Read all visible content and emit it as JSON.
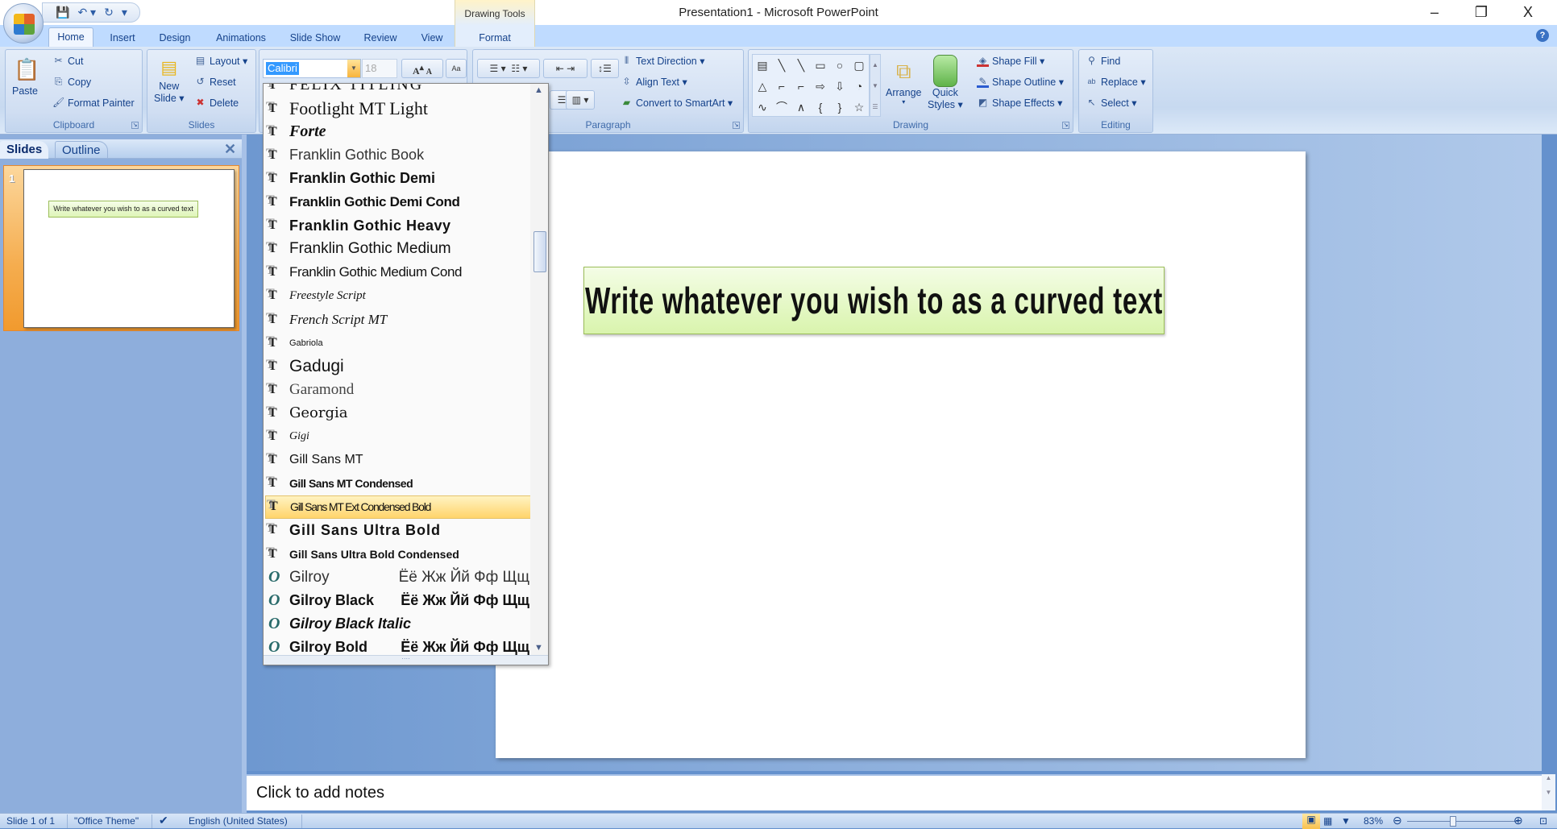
{
  "window": {
    "title": "Presentation1 - Microsoft PowerPoint",
    "minimize": "–",
    "restore": "❐",
    "close": "X"
  },
  "qat": {
    "save": "💾",
    "undo": "↶ ▾",
    "redo": "↻",
    "customize": "▾"
  },
  "contextual": {
    "header": "Drawing Tools"
  },
  "tabs": [
    "Home",
    "Insert",
    "Design",
    "Animations",
    "Slide Show",
    "Review",
    "View",
    "Format"
  ],
  "help": "?",
  "ribbon": {
    "clipboard": {
      "label": "Clipboard",
      "paste": "Paste",
      "cut": "Cut",
      "copy": "Copy",
      "format_painter": "Format Painter"
    },
    "slides": {
      "label": "Slides",
      "new_slide": "New",
      "new_slide2": "Slide ▾",
      "layout": "Layout ▾",
      "reset": "Reset",
      "delete": "Delete"
    },
    "font": {
      "font_name": "Calibri",
      "font_size": "18",
      "grow": "A",
      "shrink": "A",
      "clear": "Aa"
    },
    "paragraph": {
      "label": "Paragraph",
      "text_direction": "Text Direction ▾",
      "align_text": "Align Text ▾",
      "convert_smartart": "Convert to SmartArt ▾"
    },
    "drawing": {
      "label": "Drawing",
      "shapes": [
        "▤",
        "╲",
        "╲",
        "▭",
        "○",
        "▢",
        "△",
        "⌐",
        "⌐",
        "⇨",
        "⇩",
        "◔",
        "∿",
        "⌒",
        "∧",
        "{",
        "}",
        "☆"
      ],
      "arrange": "Arrange",
      "arrange_arrow": "▾",
      "quick_styles": "Quick",
      "quick_styles2": "Styles ▾",
      "shape_fill": "Shape Fill ▾",
      "shape_outline": "Shape Outline ▾",
      "shape_effects": "Shape Effects ▾"
    },
    "editing": {
      "label": "Editing",
      "find": "Find",
      "replace": "Replace ▾",
      "select": "Select ▾"
    }
  },
  "font_dropdown": {
    "items": [
      {
        "name": "FELIX TITLING",
        "type": "tt"
      },
      {
        "name": "Footlight MT Light",
        "type": "tt"
      },
      {
        "name": "Forte",
        "type": "tt"
      },
      {
        "name": "Franklin Gothic Book",
        "type": "tt"
      },
      {
        "name": "Franklin Gothic Demi",
        "type": "tt"
      },
      {
        "name": "Franklin Gothic Demi Cond",
        "type": "tt"
      },
      {
        "name": "Franklin Gothic Heavy",
        "type": "tt"
      },
      {
        "name": "Franklin Gothic Medium",
        "type": "tt"
      },
      {
        "name": "Franklin Gothic Medium Cond",
        "type": "tt"
      },
      {
        "name": "Freestyle Script",
        "type": "tt"
      },
      {
        "name": "French Script MT",
        "type": "tt"
      },
      {
        "name": "Gabriola",
        "type": "tt"
      },
      {
        "name": "Gadugi",
        "type": "tt"
      },
      {
        "name": "Garamond",
        "type": "tt"
      },
      {
        "name": "Georgia",
        "type": "tt"
      },
      {
        "name": "Gigi",
        "type": "tt"
      },
      {
        "name": "Gill Sans MT",
        "type": "tt"
      },
      {
        "name": "Gill Sans MT Condensed",
        "type": "tt"
      },
      {
        "name": "Gill Sans MT Ext Condensed Bold",
        "type": "tt",
        "selected": true
      },
      {
        "name": "Gill Sans Ultra Bold",
        "type": "tt"
      },
      {
        "name": "Gill Sans Ultra Bold Condensed",
        "type": "tt"
      },
      {
        "name": "Gilroy",
        "sample": "Ёё Жж Йй Фф Щщ",
        "type": "otf"
      },
      {
        "name": "Gilroy Black",
        "sample": "Ёё Жж Йй Фф Щщ",
        "type": "otf"
      },
      {
        "name": "Gilroy Black Italic",
        "type": "otf"
      },
      {
        "name": "Gilroy Bold",
        "sample": "Ёё Жж Йй Фф Щщ",
        "type": "otf"
      }
    ]
  },
  "slides_pane": {
    "tab_slides": "Slides",
    "tab_outline": "Outline",
    "close": "✕",
    "slide_number": "1",
    "thumb_text": "Write whatever you wish to as a curved text"
  },
  "slide": {
    "text": "Write whatever you wish to as a curved text"
  },
  "notes": {
    "placeholder": "Click to add notes"
  },
  "status": {
    "slide": "Slide 1 of 1",
    "theme": "\"Office Theme\"",
    "language": "English (United States)",
    "zoom": "83%",
    "zoom_percent": 83
  },
  "colors": {
    "ribbon": "#dbe7f6",
    "selection": "#ffd46b",
    "textbox_fill": "#dff5b8",
    "workspace": "#6591cd"
  }
}
